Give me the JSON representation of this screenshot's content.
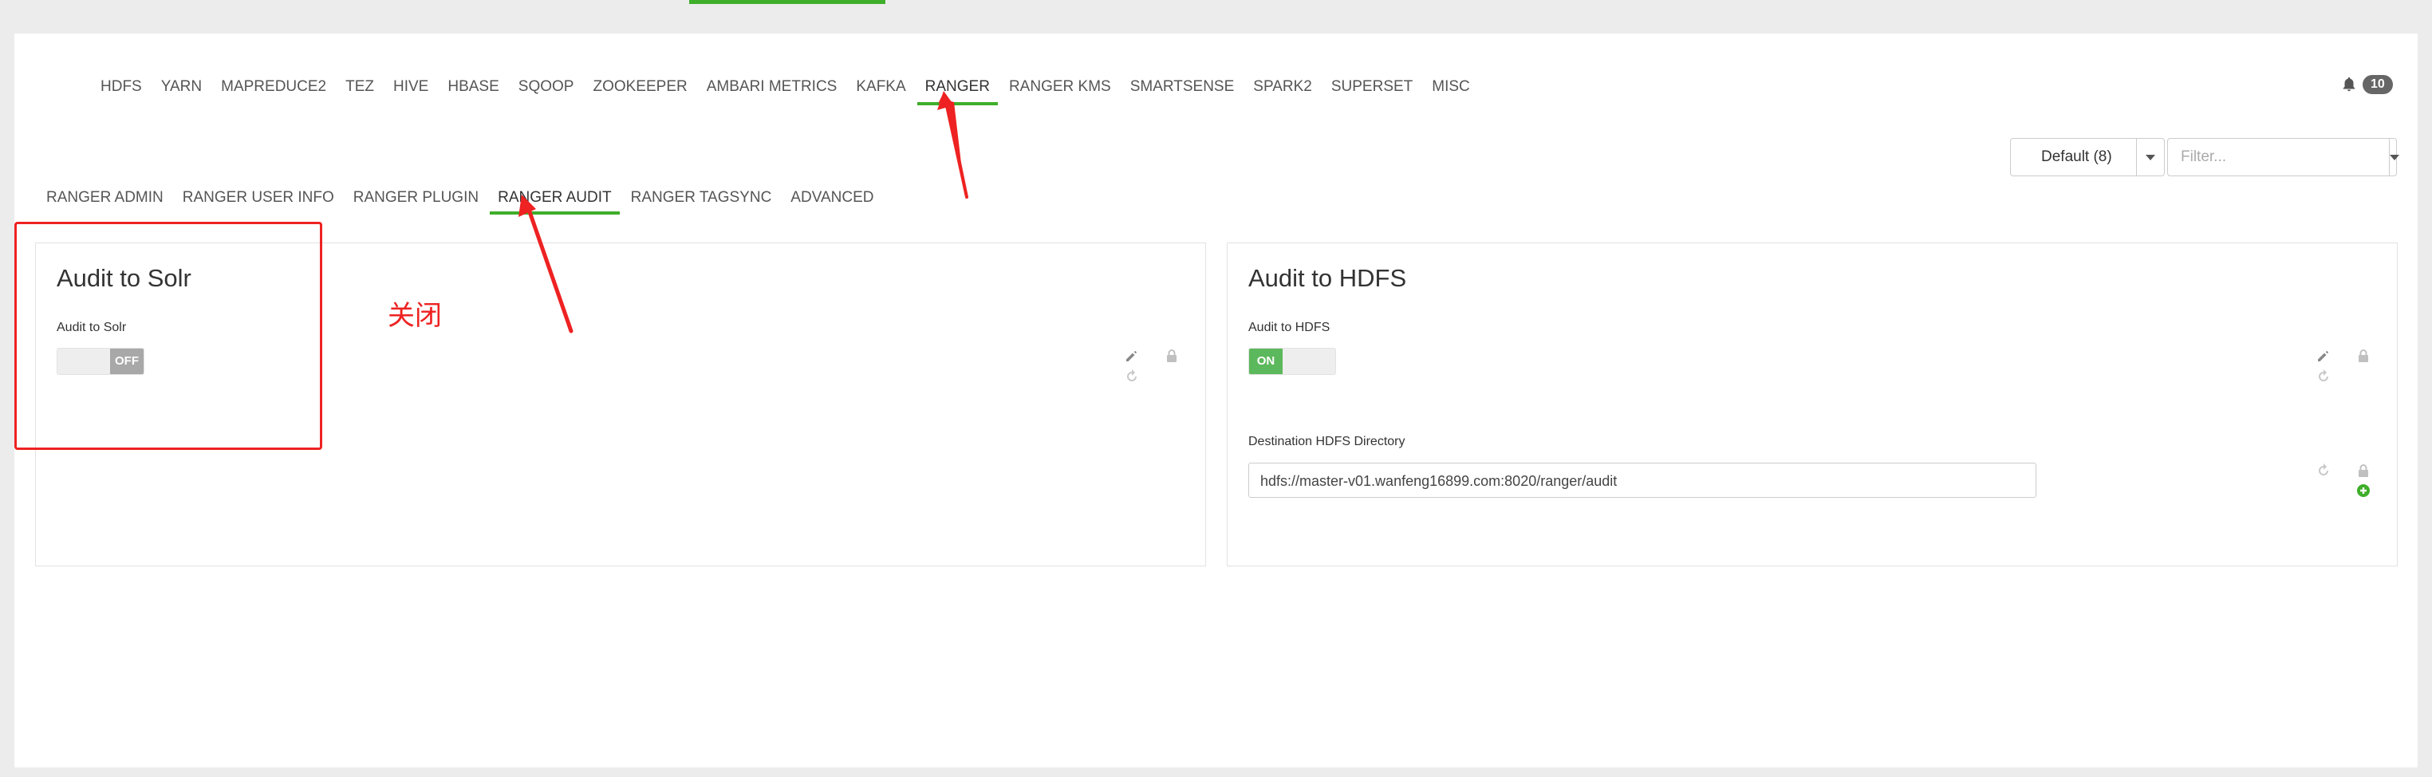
{
  "service_tabs": [
    "HDFS",
    "YARN",
    "MAPREDUCE2",
    "TEZ",
    "HIVE",
    "HBASE",
    "SQOOP",
    "ZOOKEEPER",
    "AMBARI METRICS",
    "KAFKA",
    "RANGER",
    "RANGER KMS",
    "SMARTSENSE",
    "SPARK2",
    "SUPERSET",
    "MISC"
  ],
  "active_service_tab": "RANGER",
  "notifications": {
    "count": "10",
    "icon": "bell-icon"
  },
  "config_group": {
    "selected": "Default (8)"
  },
  "filter": {
    "placeholder": "Filter..."
  },
  "sub_tabs": [
    "RANGER ADMIN",
    "RANGER USER INFO",
    "RANGER PLUGIN",
    "RANGER AUDIT",
    "RANGER TAGSYNC",
    "ADVANCED"
  ],
  "active_sub_tab": "RANGER AUDIT",
  "panels": {
    "solr": {
      "title": "Audit to Solr",
      "field_label": "Audit to Solr",
      "toggle_text": "OFF",
      "toggle_state": "off"
    },
    "hdfs": {
      "title": "Audit to HDFS",
      "field_label": "Audit to HDFS",
      "toggle_text": "ON",
      "toggle_state": "on",
      "dir_label": "Destination HDFS Directory",
      "dir_value": "hdfs://master-v01.wanfeng16899.com:8020/ranger/audit"
    }
  },
  "annotation": {
    "text": "关闭"
  },
  "colors": {
    "accent_green": "#3fae2a",
    "annotation_red": "#e22222",
    "toggle_on": "#5cb85c",
    "toggle_off": "#a8a8a8"
  }
}
